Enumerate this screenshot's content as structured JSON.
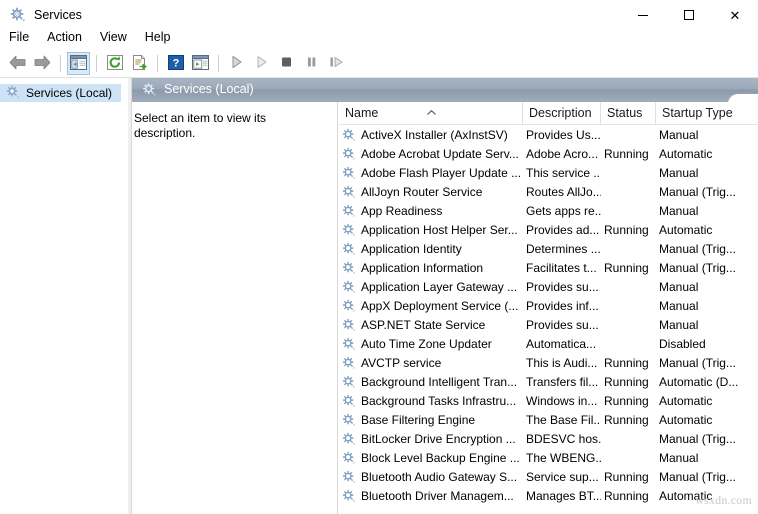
{
  "window": {
    "title": "Services",
    "title_icon": "services-gear-icon",
    "controls": {
      "minimize": "–",
      "maximize": "□",
      "close": "✕"
    }
  },
  "menubar": {
    "items": [
      "File",
      "Action",
      "View",
      "Help"
    ]
  },
  "toolbar": {
    "buttons": [
      {
        "name": "back-icon",
        "label": "Back"
      },
      {
        "name": "forward-icon",
        "label": "Forward"
      },
      {
        "name": "show-hide-console-tree-icon",
        "label": "Show/Hide Console Tree",
        "selected": true
      },
      {
        "name": "refresh-icon",
        "label": "Refresh"
      },
      {
        "name": "export-list-icon",
        "label": "Export List"
      },
      {
        "name": "help-icon",
        "label": "Help"
      },
      {
        "name": "show-hide-action-pane-icon",
        "label": "Show/Hide Action Pane"
      },
      {
        "name": "start-service-icon",
        "label": "Start Service"
      },
      {
        "name": "resume-service-icon",
        "label": "Resume Service"
      },
      {
        "name": "stop-service-icon",
        "label": "Stop Service"
      },
      {
        "name": "pause-service-icon",
        "label": "Pause Service"
      },
      {
        "name": "restart-service-icon",
        "label": "Restart Service"
      }
    ]
  },
  "sidebar": {
    "items": [
      {
        "label": "Services (Local)",
        "icon": "services-gear-icon",
        "selected": true
      }
    ]
  },
  "content": {
    "tab_label": "Services (Local)",
    "tab_icon": "services-gear-icon",
    "description_placeholder": "Select an item to view its description."
  },
  "list": {
    "columns": [
      "Name",
      "Description",
      "Status",
      "Startup Type"
    ],
    "sort_column": "Name",
    "sort_direction": "ascending",
    "rows": [
      {
        "name": "ActiveX Installer (AxInstSV)",
        "description": "Provides Us...",
        "status": "",
        "startup": "Manual"
      },
      {
        "name": "Adobe Acrobat Update Serv...",
        "description": "Adobe Acro...",
        "status": "Running",
        "startup": "Automatic"
      },
      {
        "name": "Adobe Flash Player Update ...",
        "description": "This service ...",
        "status": "",
        "startup": "Manual"
      },
      {
        "name": "AllJoyn Router Service",
        "description": "Routes AllJo...",
        "status": "",
        "startup": "Manual (Trig..."
      },
      {
        "name": "App Readiness",
        "description": "Gets apps re...",
        "status": "",
        "startup": "Manual"
      },
      {
        "name": "Application Host Helper Ser...",
        "description": "Provides ad...",
        "status": "Running",
        "startup": "Automatic"
      },
      {
        "name": "Application Identity",
        "description": "Determines ...",
        "status": "",
        "startup": "Manual (Trig..."
      },
      {
        "name": "Application Information",
        "description": "Facilitates t...",
        "status": "Running",
        "startup": "Manual (Trig..."
      },
      {
        "name": "Application Layer Gateway ...",
        "description": "Provides su...",
        "status": "",
        "startup": "Manual"
      },
      {
        "name": "AppX Deployment Service (...",
        "description": "Provides inf...",
        "status": "",
        "startup": "Manual"
      },
      {
        "name": "ASP.NET State Service",
        "description": "Provides su...",
        "status": "",
        "startup": "Manual"
      },
      {
        "name": "Auto Time Zone Updater",
        "description": "Automatica...",
        "status": "",
        "startup": "Disabled"
      },
      {
        "name": "AVCTP service",
        "description": "This is Audi...",
        "status": "Running",
        "startup": "Manual (Trig..."
      },
      {
        "name": "Background Intelligent Tran...",
        "description": "Transfers fil...",
        "status": "Running",
        "startup": "Automatic (D..."
      },
      {
        "name": "Background Tasks Infrastru...",
        "description": "Windows in...",
        "status": "Running",
        "startup": "Automatic"
      },
      {
        "name": "Base Filtering Engine",
        "description": "The Base Fil...",
        "status": "Running",
        "startup": "Automatic"
      },
      {
        "name": "BitLocker Drive Encryption ...",
        "description": "BDESVC hos...",
        "status": "",
        "startup": "Manual (Trig..."
      },
      {
        "name": "Block Level Backup Engine ...",
        "description": "The WBENG...",
        "status": "",
        "startup": "Manual"
      },
      {
        "name": "Bluetooth Audio Gateway S...",
        "description": "Service sup...",
        "status": "Running",
        "startup": "Manual (Trig..."
      },
      {
        "name": "Bluetooth Driver Managem...",
        "description": "Manages BT...",
        "status": "Running",
        "startup": "Automatic"
      }
    ]
  },
  "watermark": {
    "text": "wsxdn.com"
  },
  "colors": {
    "tab_strip_top": "#a8b5c4",
    "tab_strip_bottom": "#9fadbd",
    "sidebar_selection": "#cde2f5",
    "toolbar_selected": "#d8eaf7",
    "gear_blue": "#6f93b5",
    "green": "#4a9c2e",
    "help_blue": "#1a5fa8"
  }
}
